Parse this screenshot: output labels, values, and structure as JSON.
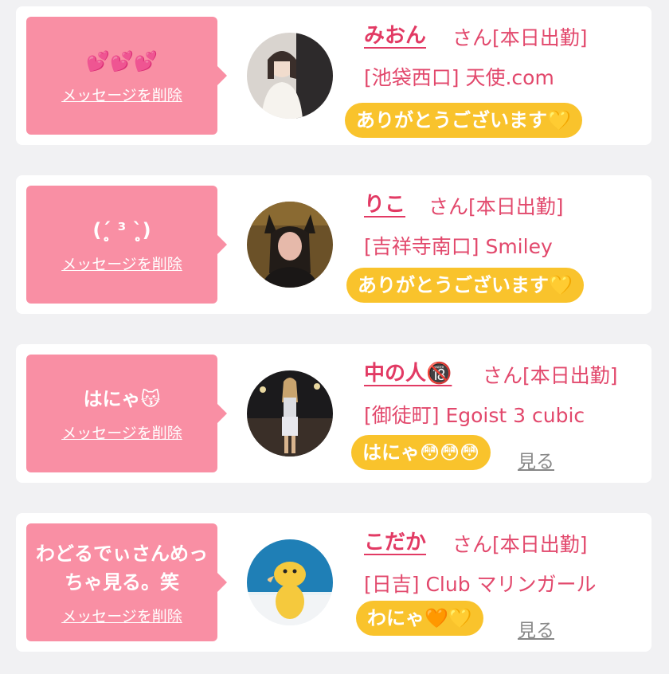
{
  "cards": [
    {
      "message": "💕💕💕",
      "delete_label": "メッセージを削除",
      "name": "みおん",
      "suffix": "さん[本日出勤]",
      "shop": "[池袋西口] 天使.com",
      "reply": "ありがとうございます💛"
    },
    {
      "message": "(ˊ̥̥̥̥̥ ³ ˋ̥̥̥̥̥)",
      "delete_label": "メッセージを削除",
      "name": "りこ",
      "suffix": "さん[本日出勤]",
      "shop": "[吉祥寺南口] Smiley",
      "reply": "ありがとうございます💛"
    },
    {
      "message": "はにゃ😽",
      "delete_label": "メッセージを削除",
      "name": "中の人🔞",
      "suffix": "さん[本日出勤]",
      "shop": "[御徒町] Egoist 3 cubic",
      "view_link": "見る",
      "reply": "はにゃ😳😳😳"
    },
    {
      "message": "わどるでぃさんめっちゃ見る。笑",
      "delete_label": "メッセージを削除",
      "name": "こだか",
      "suffix": "さん[本日出勤]",
      "shop": "[日吉] Club マリンガール",
      "view_link": "見る",
      "reply": "わにゃ🧡💛"
    }
  ],
  "colors": {
    "bubble": "#f98fa4",
    "name": "#e23a64",
    "pill": "#f9c32c"
  }
}
